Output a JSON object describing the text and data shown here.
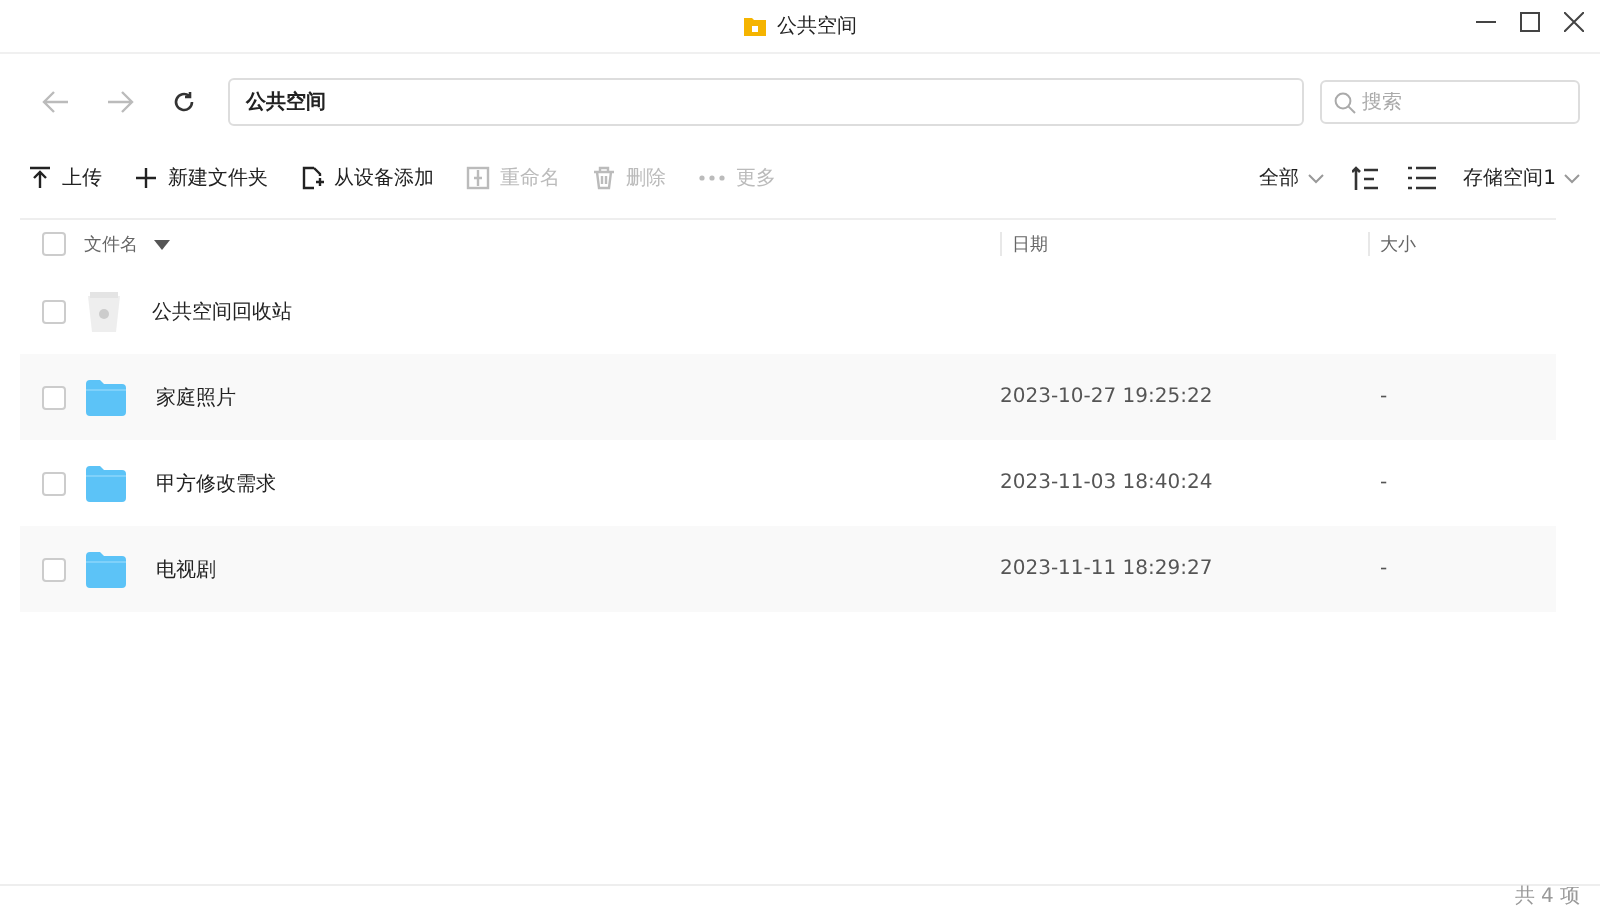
{
  "window": {
    "title": "公共空间"
  },
  "path": {
    "value": "公共空间"
  },
  "search": {
    "placeholder": "搜索"
  },
  "toolbar": [
    {
      "kind": "upload",
      "label": "上传",
      "disabled": false
    },
    {
      "kind": "new-folder",
      "label": "新建文件夹",
      "disabled": false
    },
    {
      "kind": "add-device",
      "label": "从设备添加",
      "disabled": false
    },
    {
      "kind": "rename",
      "label": "重命名",
      "disabled": true
    },
    {
      "kind": "delete",
      "label": "删除",
      "disabled": true
    },
    {
      "kind": "more",
      "label": "更多",
      "disabled": true
    }
  ],
  "filter": {
    "label": "全部"
  },
  "storage": {
    "label": "存储空间1"
  },
  "table": {
    "header_checked": false,
    "columns": [
      "文件名",
      "日期",
      "大小"
    ],
    "rows": [
      {
        "kind": "trash",
        "name": "公共空间回收站",
        "checked": false
      },
      {
        "kind": "folder",
        "name": "家庭照片",
        "date": "2023-10-27 19:25:22",
        "size": "-",
        "checked": false
      },
      {
        "kind": "folder",
        "name": "甲方修改需求",
        "date": "2023-11-03 18:40:24",
        "size": "-",
        "checked": false
      },
      {
        "kind": "folder",
        "name": "电视剧",
        "date": "2023-11-11 18:29:27",
        "size": "-",
        "checked": false
      }
    ]
  },
  "status_bar": {
    "count": "共 4 项"
  }
}
